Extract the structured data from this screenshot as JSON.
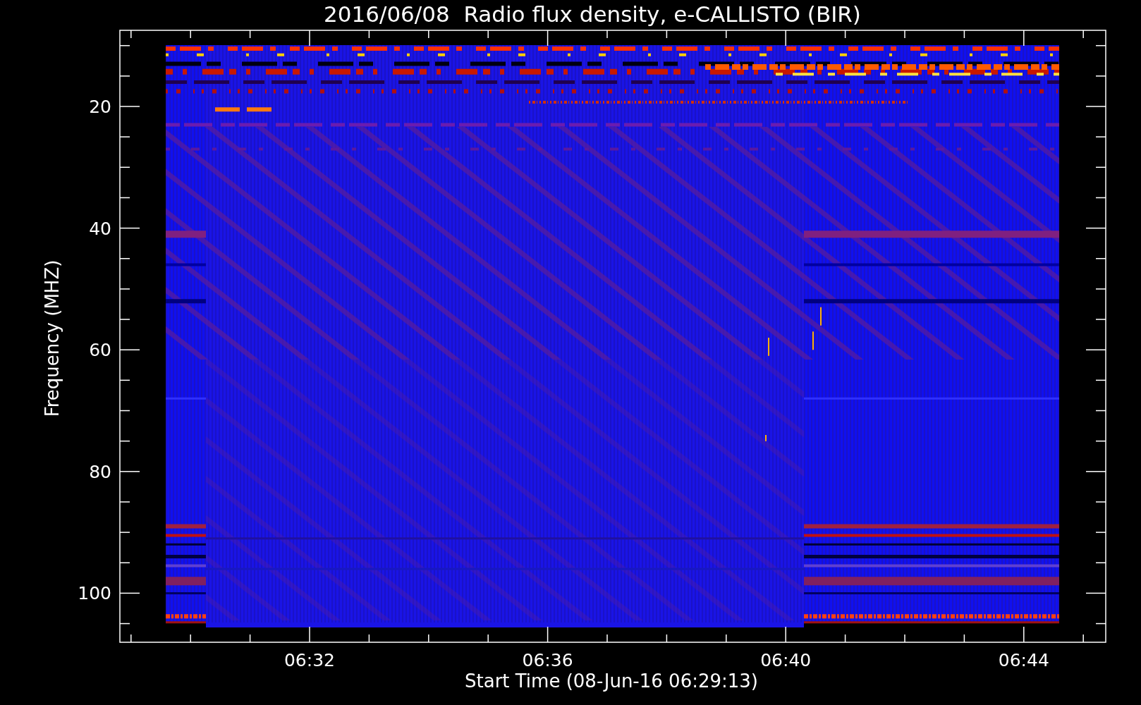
{
  "title": "2016/06/08  Radio flux density, e-CALLISTO (BIR)",
  "y_axis": {
    "label": "Frequency (MHZ)",
    "ticks": [
      "20",
      "40",
      "60",
      "80",
      "100"
    ]
  },
  "x_axis": {
    "label": "Start Time (08-Jun-16 06:29:13)",
    "ticks": [
      "06:32",
      "06:36",
      "06:40",
      "06:44"
    ]
  }
}
